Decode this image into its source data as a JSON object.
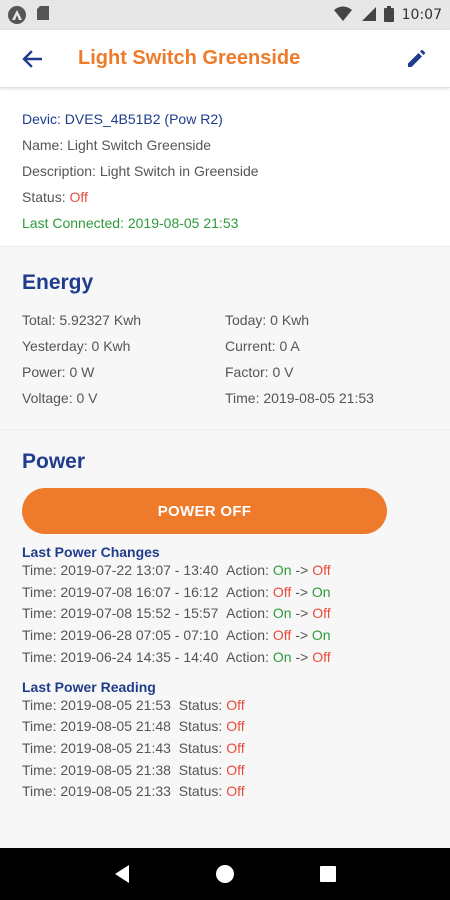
{
  "status_bar": {
    "time": "10:07"
  },
  "app_bar": {
    "title": "Light Switch Greenside"
  },
  "info": {
    "device_label": "Devic:",
    "device_value": "DVES_4B51B2 (Pow R2)",
    "name_label": "Name:",
    "name_value": "Light Switch Greenside",
    "description_label": "Description:",
    "description_value": "Light Switch in Greenside",
    "status_label": "Status:",
    "status_value": "Off",
    "connected_label": "Last Connected:",
    "connected_value": "2019-08-05 21:53"
  },
  "energy": {
    "title": "Energy",
    "items": [
      "Total: 5.92327 Kwh",
      "Today: 0 Kwh",
      "Yesterday: 0 Kwh",
      "Current: 0 A",
      "Power: 0 W",
      "Factor: 0 V",
      "Voltage: 0 V",
      "Time: 2019-08-05 21:53"
    ]
  },
  "power": {
    "title": "Power",
    "button_label": "POWER OFF",
    "changes_title": "Last Power Changes",
    "changes": [
      {
        "time": "Time: 2019-07-22 13:07 - 13:40",
        "action_label": "Action:",
        "from": "On",
        "arrow": "->",
        "to": "Off"
      },
      {
        "time": "Time: 2019-07-08 16:07 - 16:12",
        "action_label": "Action:",
        "from": "Off",
        "arrow": "->",
        "to": "On"
      },
      {
        "time": "Time: 2019-07-08 15:52 - 15:57",
        "action_label": "Action:",
        "from": "On",
        "arrow": "->",
        "to": "Off"
      },
      {
        "time": "Time: 2019-06-28 07:05 - 07:10",
        "action_label": "Action:",
        "from": "Off",
        "arrow": "->",
        "to": "On"
      },
      {
        "time": "Time: 2019-06-24 14:35 - 14:40",
        "action_label": "Action:",
        "from": "On",
        "arrow": "->",
        "to": "Off"
      }
    ],
    "readings_title": "Last Power Reading",
    "readings": [
      {
        "time": "Time: 2019-08-05 21:53",
        "status_label": "Status:",
        "status": "Off"
      },
      {
        "time": "Time: 2019-08-05 21:48",
        "status_label": "Status:",
        "status": "Off"
      },
      {
        "time": "Time: 2019-08-05 21:43",
        "status_label": "Status:",
        "status": "Off"
      },
      {
        "time": "Time: 2019-08-05 21:38",
        "status_label": "Status:",
        "status": "Off"
      },
      {
        "time": "Time: 2019-08-05 21:33",
        "status_label": "Status:",
        "status": "Off"
      }
    ]
  },
  "colors": {
    "accent": "#ef7b2a",
    "primary": "#1f3d8c",
    "on": "#2e9a3a",
    "off": "#e74c3c"
  },
  "icons": {
    "back": "arrow-back-icon",
    "edit": "pencil-icon",
    "nav_back": "triangle-back-icon",
    "nav_home": "circle-home-icon",
    "nav_recent": "square-recents-icon"
  }
}
